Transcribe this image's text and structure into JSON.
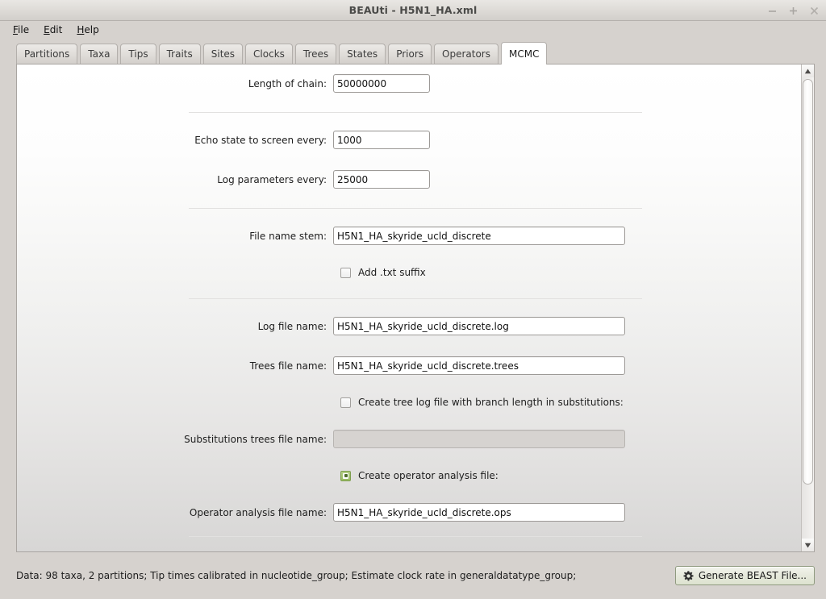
{
  "window": {
    "title": "BEAUti - H5N1_HA.xml",
    "buttons": [
      {
        "name": "minimize",
        "glyph": "−"
      },
      {
        "name": "maximize",
        "glyph": "+"
      },
      {
        "name": "close",
        "glyph": "×"
      }
    ]
  },
  "menubar": {
    "items": [
      {
        "mnemonic": "F",
        "rest": "ile"
      },
      {
        "mnemonic": "E",
        "rest": "dit"
      },
      {
        "mnemonic": "H",
        "rest": "elp"
      }
    ]
  },
  "tabs": {
    "active": "MCMC",
    "items": [
      {
        "label": "Partitions"
      },
      {
        "label": "Taxa"
      },
      {
        "label": "Tips"
      },
      {
        "label": "Traits"
      },
      {
        "label": "Sites"
      },
      {
        "label": "Clocks"
      },
      {
        "label": "Trees"
      },
      {
        "label": "States"
      },
      {
        "label": "Priors"
      },
      {
        "label": "Operators"
      },
      {
        "label": "MCMC"
      }
    ]
  },
  "form": {
    "length_of_chain": {
      "label": "Length of chain:",
      "value": "50000000"
    },
    "echo_state": {
      "label": "Echo state to screen every:",
      "value": "1000"
    },
    "log_parameters": {
      "label": "Log parameters every:",
      "value": "25000"
    },
    "file_name_stem": {
      "label": "File name stem:",
      "value": "H5N1_HA_skyride_ucld_discrete"
    },
    "add_txt_suffix": {
      "label": "Add .txt suffix",
      "checked": false
    },
    "log_file_name": {
      "label": "Log file name:",
      "value": "H5N1_HA_skyride_ucld_discrete.log"
    },
    "trees_file_name": {
      "label": "Trees file name:",
      "value": "H5N1_HA_skyride_ucld_discrete.trees"
    },
    "create_tree_log_substitutions": {
      "label": "Create tree log file with branch length in substitutions:",
      "checked": false
    },
    "substitutions_trees_file_name": {
      "label": "Substitutions trees file name:",
      "value": "",
      "disabled": true
    },
    "create_operator_analysis": {
      "label": "Create operator analysis file:",
      "checked": true
    },
    "operator_analysis_file_name": {
      "label": "Operator analysis file name:",
      "value": "H5N1_HA_skyride_ucld_discrete.ops"
    }
  },
  "statusbar": {
    "text": "Data: 98 taxa, 2 partitions; Tip times calibrated in nucleotide_group; Estimate clock rate in generaldatatype_group;",
    "generate_button": "Generate BEAST File..."
  },
  "colors": {
    "window_bg": "#d6d2ce",
    "panel_top": "#ffffff",
    "panel_bottom": "#d7d6d5",
    "accent_check": "#98bb62",
    "generate_btn_bg": "#e6e9dc"
  }
}
